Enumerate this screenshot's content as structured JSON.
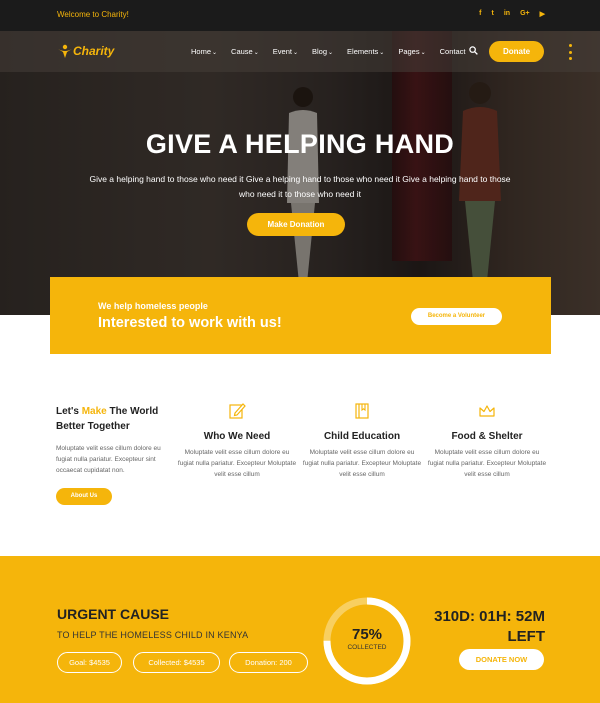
{
  "topbar": {
    "welcome": "Welcome to Charity!",
    "socials": [
      {
        "icon": "facebook-icon",
        "glyph": "f"
      },
      {
        "icon": "twitter-icon",
        "glyph": "t"
      },
      {
        "icon": "linkedin-icon",
        "glyph": "in"
      },
      {
        "icon": "google-plus-icon",
        "glyph": "G+"
      },
      {
        "icon": "youtube-icon",
        "glyph": "▶"
      }
    ]
  },
  "nav": {
    "logo_text": "Charity",
    "items": [
      {
        "label": "Home"
      },
      {
        "label": "Cause"
      },
      {
        "label": "Event"
      },
      {
        "label": "Blog"
      },
      {
        "label": "Elements"
      },
      {
        "label": "Pages"
      },
      {
        "label": "Contact"
      }
    ],
    "donate_label": "Donate"
  },
  "hero": {
    "title": "GIVE A HELPING HAND",
    "subtitle": "Give a helping hand to those who need it Give a helping hand to those who need it Give a helping hand to those who need it to those who need it",
    "button": "Make Donation"
  },
  "volunteer": {
    "small": "We help homeless people",
    "big": "Interested to work with us!",
    "button": "Become a Volunteer"
  },
  "intro": {
    "title_pre": "Let's ",
    "title_highlight": "Make",
    "title_post": " The World Better Together",
    "text": "Moluptate velit esse cillum dolore eu fugiat nulla pariatur. Excepteur sint occaecat cupidatat non.",
    "button": "About Us"
  },
  "features": [
    {
      "title": "Who We Need",
      "icon": "edit-icon",
      "text": "Moluptate velit esse cillum dolore eu fugiat nulla pariatur. Excepteur Moluptate velit esse cillum"
    },
    {
      "title": "Child Education",
      "icon": "book-icon",
      "text": "Moluptate velit esse cillum dolore eu fugiat nulla pariatur. Excepteur Moluptate velit esse cillum"
    },
    {
      "title": "Food & Shelter",
      "icon": "crown-icon",
      "text": "Moluptate velit esse cillum dolore eu fugiat nulla pariatur. Excepteur Moluptate velit esse cillum"
    }
  ],
  "urgent": {
    "title": "URGENT CAUSE",
    "cause": "TO HELP THE HOMELESS CHILD IN KENYA",
    "goal": "Goal: $4535",
    "collected": "Collected: $4535",
    "donation": "Donation: 200",
    "percent_label": "75%",
    "percent_value": 0.75,
    "collected_label": "COLLECTED",
    "countdown_line1": "310D: 01H: 52M",
    "countdown_line2": "LEFT",
    "button": "DONATE NOW"
  },
  "colors": {
    "accent": "#f5b50b",
    "dark": "#1b1b1b"
  }
}
